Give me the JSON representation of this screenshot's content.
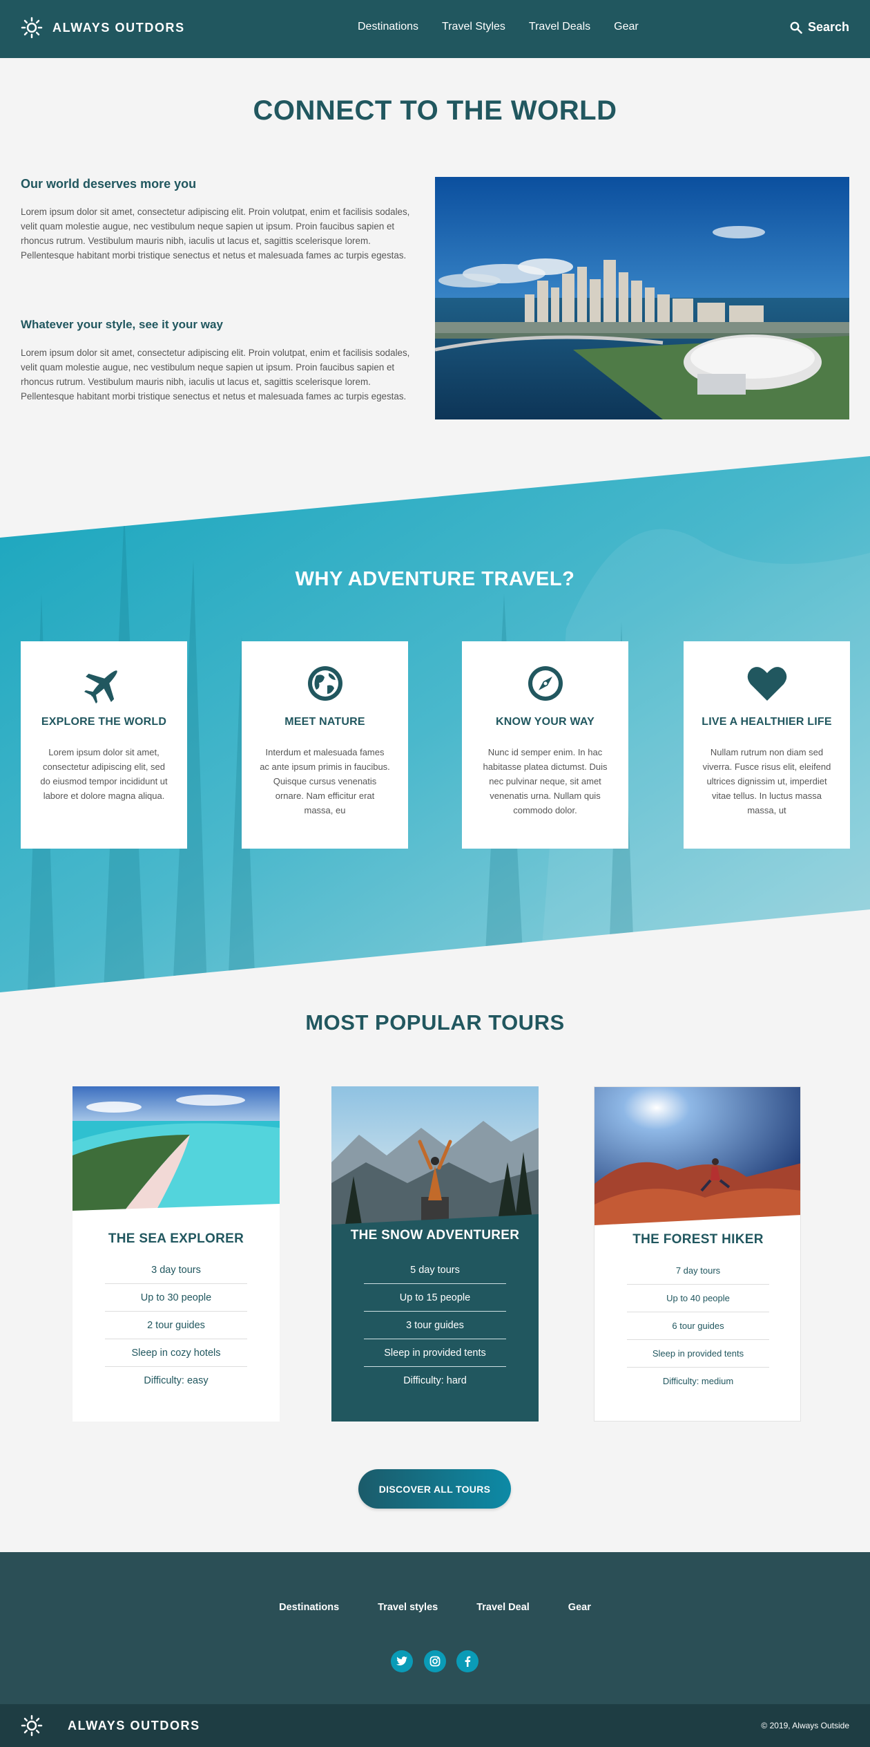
{
  "header": {
    "brand": "ALWAYS OUTDORS",
    "nav": [
      "Destinations",
      "Travel Styles",
      "Travel Deals",
      "Gear"
    ],
    "search_label": "Search"
  },
  "intro": {
    "title": "CONNECT TO THE WORLD",
    "blocks": [
      {
        "heading": "Our world deserves more you",
        "text": "Lorem ipsum dolor sit amet, consectetur adipiscing elit. Proin volutpat, enim et facilisis sodales, velit quam molestie augue, nec vestibulum neque sapien ut ipsum. Proin faucibus sapien et rhoncus rutrum. Vestibulum mauris nibh, iaculis ut lacus et, sagittis scelerisque lorem. Pellentesque habitant morbi tristique senectus et netus et malesuada fames ac turpis egestas."
      },
      {
        "heading": "Whatever your style, see it your way",
        "text": "Lorem ipsum dolor sit amet, consectetur adipiscing elit. Proin volutpat, enim et facilisis sodales, velit quam molestie augue, nec vestibulum neque sapien ut ipsum. Proin faucibus sapien et rhoncus rutrum. Vestibulum mauris nibh, iaculis ut lacus et, sagittis scelerisque lorem. Pellentesque habitant morbi tristique senectus et netus et malesuada fames ac turpis egestas."
      }
    ]
  },
  "why": {
    "title": "WHY ADVENTURE TRAVEL?",
    "cards": [
      {
        "icon": "airplane-icon",
        "title": "EXPLORE THE WORLD",
        "text": "Lorem ipsum dolor sit amet, consectetur adipiscing elit, sed do eiusmod tempor incididunt ut labore et dolore magna aliqua."
      },
      {
        "icon": "globe-icon",
        "title": "MEET NATURE",
        "text": "Interdum et malesuada fames ac ante ipsum primis in faucibus. Quisque cursus venenatis ornare. Nam efficitur erat massa, eu"
      },
      {
        "icon": "compass-icon",
        "title": "KNOW YOUR WAY",
        "text": "Nunc id semper enim. In hac habitasse platea dictumst. Duis nec pulvinar neque, sit amet venenatis urna. Nullam quis commodo dolor."
      },
      {
        "icon": "heart-icon",
        "title": "LIVE A HEALTHIER LIFE",
        "text": "Nullam rutrum non diam sed viverra. Fusce risus elit, eleifend ultrices dignissim ut, imperdiet vitae tellus. In luctus massa massa, ut"
      }
    ]
  },
  "tours": {
    "title": "MOST POPULAR TOURS",
    "items": [
      {
        "name": "THE SEA EXPLORER",
        "details": [
          "3 day tours",
          "Up to 30 people",
          "2 tour guides",
          "Sleep in cozy hotels",
          "Difficulty: easy"
        ]
      },
      {
        "name": "THE SNOW ADVENTURER",
        "details": [
          "5 day tours",
          "Up to 15 people",
          "3 tour guides",
          "Sleep in provided tents",
          "Difficulty: hard"
        ]
      },
      {
        "name": "THE FOREST HIKER",
        "details": [
          "7 day tours",
          "Up to 40 people",
          "6 tour guides",
          "Sleep in provided tents",
          "Difficulty: medium"
        ]
      }
    ],
    "button": "DISCOVER ALL TOURS"
  },
  "footer": {
    "nav": [
      "Destinations",
      "Travel styles",
      "Travel Deal",
      "Gear"
    ],
    "social": [
      "twitter-icon",
      "instagram-icon",
      "facebook-icon"
    ],
    "brand": "ALWAYS OUTDORS",
    "copyright": "© 2019, Always Outside"
  },
  "colors": {
    "primary": "#21575f",
    "accent": "#0a9bb7",
    "footer": "#2b4f56",
    "footer_bar": "#1e3d43"
  }
}
